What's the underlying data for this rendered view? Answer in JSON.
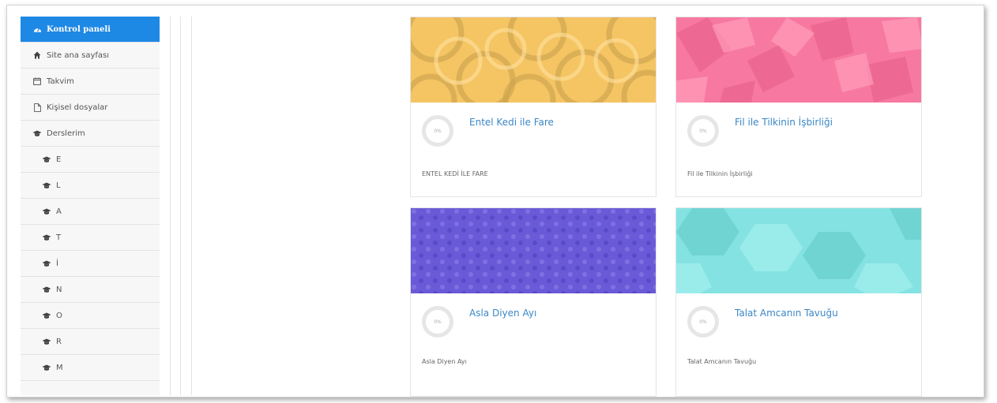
{
  "sidebar": {
    "items": [
      {
        "label": "Kontrol paneli",
        "icon": "dashboard-icon",
        "active": true
      },
      {
        "label": "Site ana sayfası",
        "icon": "home-icon"
      },
      {
        "label": "Takvim",
        "icon": "calendar-icon"
      },
      {
        "label": "Kişisel dosyalar",
        "icon": "file-icon"
      },
      {
        "label": "Derslerim",
        "icon": "graduation-cap-icon"
      }
    ],
    "courses": [
      "E",
      "L",
      "A",
      "T",
      "İ",
      "N",
      "O",
      "R",
      "M"
    ]
  },
  "courses": [
    {
      "title": "Entel Kedi ile Fare",
      "summary": "ENTEL KEDİ İLE FARE",
      "progress": "0%",
      "color": "#f5c463"
    },
    {
      "title": "Fil ile Tilkinin İşbirliği",
      "summary": "Fil ile Tilkinin İşbirliği",
      "progress": "0%",
      "color": "#f778a1"
    },
    {
      "title": "Asla Diyen Ayı",
      "summary": "Asla Diyen Ayı",
      "progress": "0%",
      "color": "#6a5ad7"
    },
    {
      "title": "Talat Amcanın Tavuğu",
      "summary": "Talat Amcanın Tavuğu",
      "progress": "0%",
      "color": "#84e3e2"
    }
  ]
}
